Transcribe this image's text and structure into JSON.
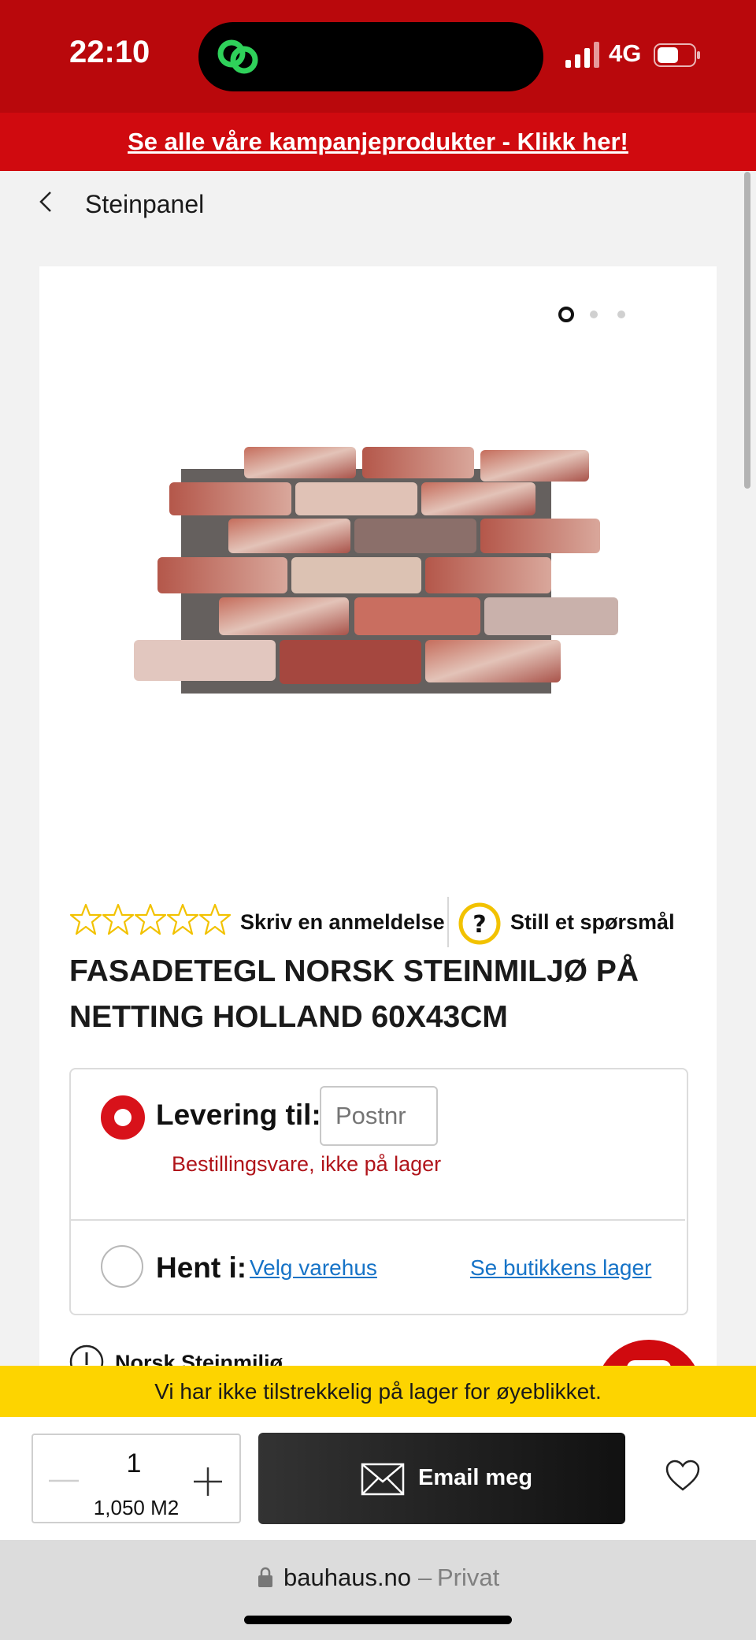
{
  "status_bar": {
    "time": "22:10",
    "network": "4G",
    "icons": [
      "signal-icon",
      "battery-icon",
      "link-app-icon"
    ]
  },
  "campaign": {
    "text": "Se alle våre kampanjeprodukter - Klikk her!"
  },
  "breadcrumb": {
    "back_icon": "chevron-left-icon",
    "label": "Steinpanel"
  },
  "gallery": {
    "image_count": 3,
    "active_index": 0
  },
  "rating": {
    "stars": 0,
    "max_stars": 5,
    "review_link": "Skriv en anmeldelse",
    "question_link": "Still et spørsmål"
  },
  "product": {
    "title_line1": "FASADETEGL NORSK STEINMILJØ PÅ",
    "title_line2": "NETTING HOLLAND 60X43CM"
  },
  "delivery": {
    "deliver_label": "Levering til:",
    "postnr_placeholder": "Postnr",
    "stock_note": "Bestillingsvare, ikke på lager",
    "pickup_label": "Hent i:",
    "store_link": "Velg varehus",
    "stock_link": "Se butikkens lager"
  },
  "supplier": {
    "name": "Norsk Steinmiljø"
  },
  "stock_banner": {
    "text": "Vi har ikke tilstrekkelig på lager for øyeblikket."
  },
  "purchase": {
    "quantity": "1",
    "unit_amount": "1,050 M2",
    "email_label": "Email meg"
  },
  "browser": {
    "url": "bauhaus.no",
    "separator": "–",
    "mode": "Privat"
  },
  "colors": {
    "brand_red": "#d00a0f",
    "status_red": "#b9080c",
    "warning_yellow": "#fdd400",
    "star_outline": "#f2c200",
    "link_blue": "#1673c7",
    "error_text": "#b0141a"
  }
}
